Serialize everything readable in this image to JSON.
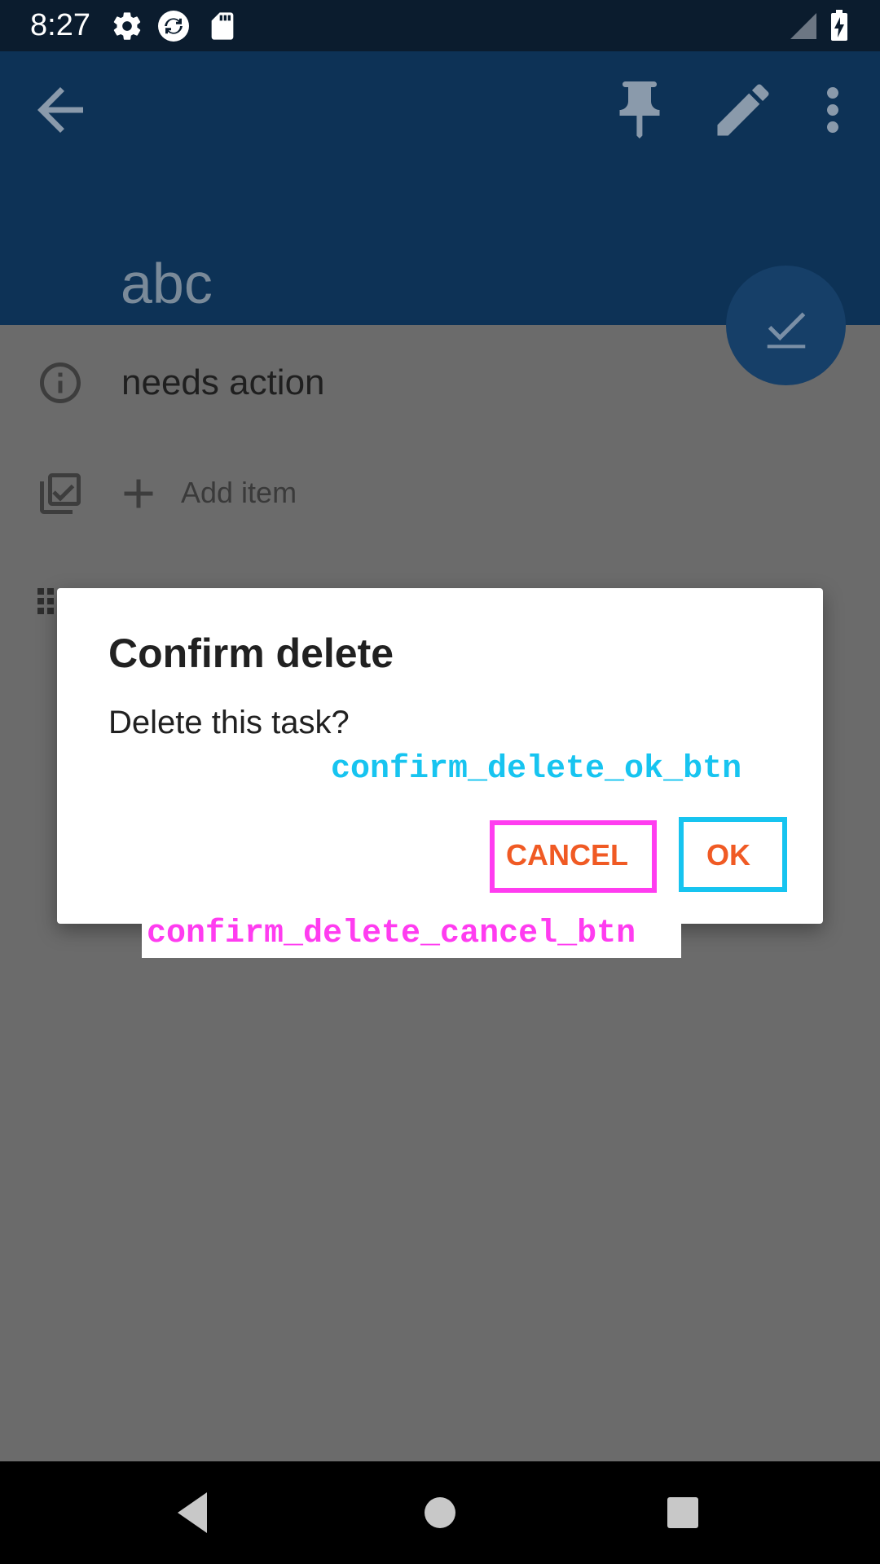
{
  "status_bar": {
    "time": "8:27",
    "icons": [
      "settings-icon",
      "sync-icon",
      "sd-card-icon",
      "signal-icon",
      "battery-charging-icon"
    ]
  },
  "app_bar": {
    "back_icon": "back-arrow-icon",
    "actions": [
      "pin-icon",
      "edit-icon",
      "more-vert-icon"
    ],
    "task_title": "abc"
  },
  "fab": {
    "icon": "check-icon"
  },
  "task_details": {
    "status_icon": "info-icon",
    "status": "needs action",
    "checklist_icon": "checklist-icon",
    "add_icon": "plus-icon",
    "add_item_label": "Add item",
    "partial_icon": "grid-dots-icon"
  },
  "dialog": {
    "title": "Confirm delete",
    "message": "Delete this task?",
    "cancel_label": "CANCEL",
    "ok_label": "OK"
  },
  "annotations": {
    "ok_label": "confirm_delete_ok_btn",
    "cancel_label": "confirm_delete_cancel_btn",
    "ok_color": "#17c4f0",
    "cancel_color": "#ff3cf0"
  },
  "nav_bar": {
    "buttons": [
      "back-triangle-icon",
      "home-circle-icon",
      "recents-square-icon"
    ]
  },
  "colors": {
    "primary": "#0d3256",
    "scrim": "#6b6b6b",
    "accent": "#f05a24"
  }
}
